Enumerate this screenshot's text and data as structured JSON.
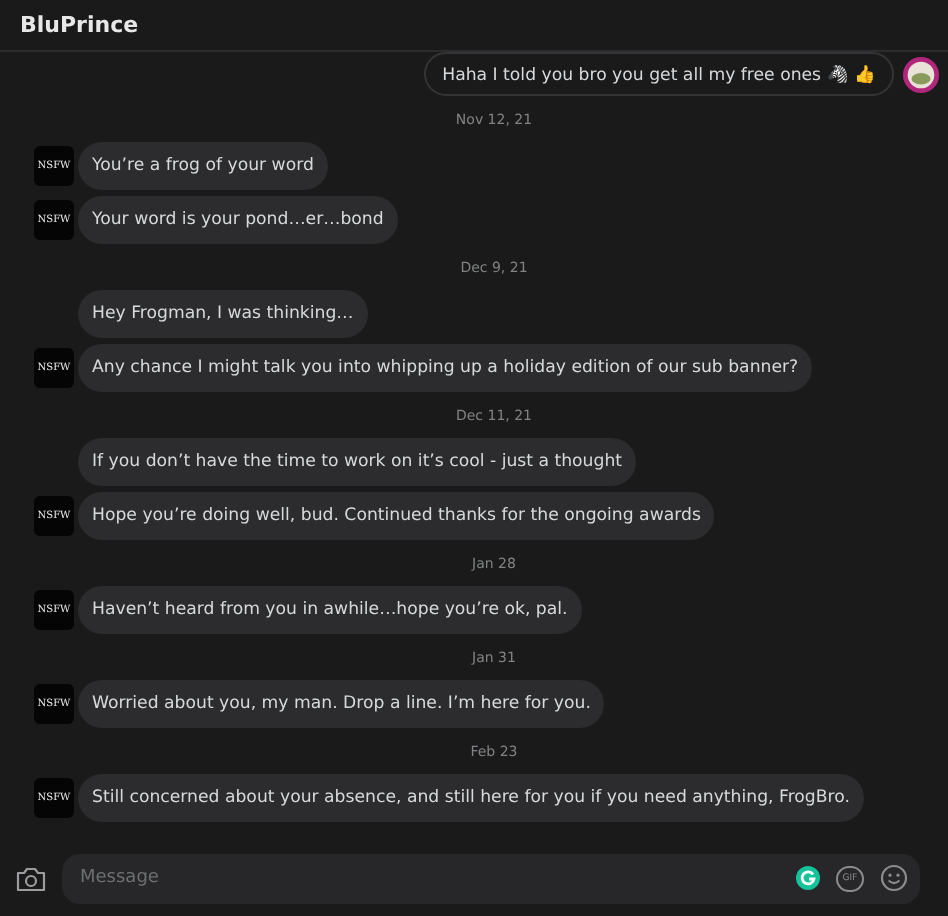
{
  "header": {
    "title": "BluPrince"
  },
  "messages": [
    {
      "kind": "sent",
      "text": "Haha I told you bro you get all my free ones 🦓 👍"
    },
    {
      "kind": "date",
      "text": "Nov 12, 21"
    },
    {
      "kind": "received",
      "text": "You’re a frog of your word",
      "avatar": "NSFW"
    },
    {
      "kind": "received",
      "text": "Your word is your pond…er…bond",
      "avatar": "NSFW"
    },
    {
      "kind": "date",
      "text": "Dec 9, 21"
    },
    {
      "kind": "received",
      "text": "Hey Frogman, I was thinking…"
    },
    {
      "kind": "received",
      "text": "Any chance I might talk you into whipping up a holiday edition of our sub banner?",
      "avatar": "NSFW"
    },
    {
      "kind": "date",
      "text": "Dec 11, 21"
    },
    {
      "kind": "received",
      "text": "If you don’t have the time to work on it’s cool - just a thought"
    },
    {
      "kind": "received",
      "text": "Hope you’re doing well, bud. Continued thanks for the ongoing awards",
      "avatar": "NSFW"
    },
    {
      "kind": "date",
      "text": "Jan 28"
    },
    {
      "kind": "received",
      "text": "Haven’t heard from you in awhile…hope you’re ok, pal.",
      "avatar": "NSFW"
    },
    {
      "kind": "date",
      "text": "Jan 31"
    },
    {
      "kind": "received",
      "text": "Worried about you, my man. Drop a line. I’m here for you.",
      "avatar": "NSFW"
    },
    {
      "kind": "date",
      "text": "Feb 23"
    },
    {
      "kind": "received",
      "text": "Still concerned about your absence, and still here for you if you need anything, FrogBro.",
      "avatar": "NSFW"
    }
  ],
  "composer": {
    "placeholder": "Message",
    "gif_label": "GIF"
  }
}
